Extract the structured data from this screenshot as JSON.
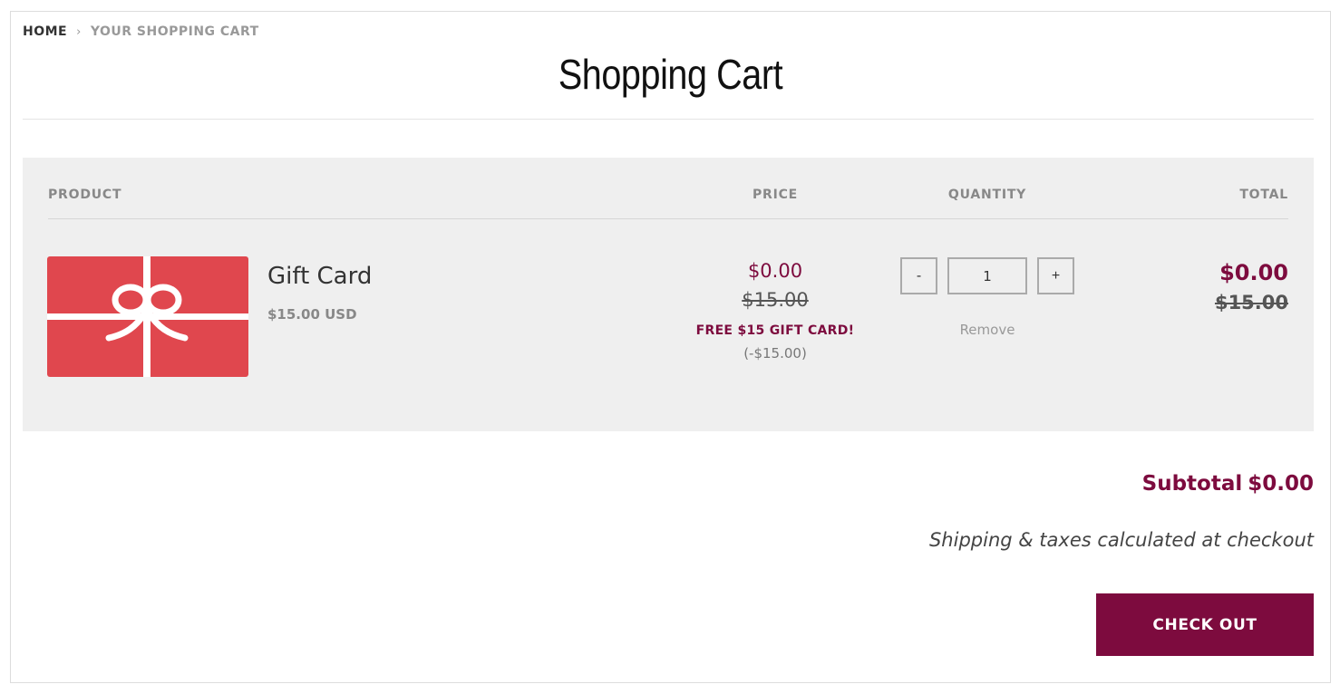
{
  "breadcrumb": {
    "home": "HOME",
    "separator": "›",
    "current": "YOUR SHOPPING CART"
  },
  "page_title": "Shopping Cart",
  "table": {
    "headers": {
      "product": "PRODUCT",
      "price": "PRICE",
      "quantity": "QUANTITY",
      "total": "TOTAL"
    }
  },
  "items": [
    {
      "name": "Gift Card",
      "variant_price": "$15.00 USD",
      "image_icon": "gift-card-image",
      "price_current": "$0.00",
      "price_original": "$15.00",
      "discount_label": "FREE $15 GIFT CARD!",
      "discount_amount": "(-$15.00)",
      "quantity": "1",
      "decrement_label": "-",
      "increment_label": "+",
      "remove_label": "Remove",
      "total_current": "$0.00",
      "total_original": "$15.00"
    }
  ],
  "summary": {
    "subtotal_label": "Subtotal",
    "subtotal_value": "$0.00",
    "shipping_note": "Shipping & taxes calculated at checkout",
    "checkout_label": "CHECK OUT"
  },
  "colors": {
    "accent": "#7d0b3e",
    "panel_bg": "#efefef",
    "gift_card_red": "#e0474e"
  }
}
